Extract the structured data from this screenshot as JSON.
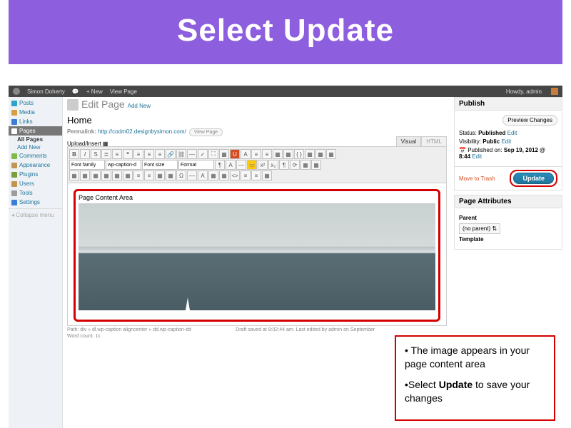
{
  "slide": {
    "title": "Select Update"
  },
  "adminbar": {
    "site": "Simon Doherty",
    "new": "+ New",
    "viewpage": "View Page",
    "howdy": "Howdy, admin"
  },
  "sidebar": {
    "items": [
      {
        "label": "Posts",
        "icon": "#2ea2cc"
      },
      {
        "label": "Media",
        "icon": "#d6a040"
      },
      {
        "label": "Links",
        "icon": "#3a7dd6"
      },
      {
        "label": "Pages",
        "icon": "#9c9c9c",
        "current": true
      },
      {
        "label": "Comments",
        "icon": "#7dbb49"
      },
      {
        "label": "Appearance",
        "icon": "#c29455"
      },
      {
        "label": "Plugins",
        "icon": "#7d9e3d"
      },
      {
        "label": "Users",
        "icon": "#c2954f"
      },
      {
        "label": "Tools",
        "icon": "#9c9c9c"
      },
      {
        "label": "Settings",
        "icon": "#3a7dd6"
      }
    ],
    "subpages": {
      "all": "All Pages",
      "add": "Add New"
    },
    "collapse": "Collapse menu"
  },
  "page": {
    "heading": "Edit Page",
    "addnew": "Add New",
    "title": "Home",
    "permalink_label": "Permalink:",
    "permalink_url": "http://codm02.designbysimon.com/",
    "viewpage_btn": "View Page",
    "upload": "Upload/Insert",
    "visual": "Visual",
    "html": "HTML",
    "font_family": "Font family",
    "caption_style": "wp-caption-d",
    "font_size": "Font size",
    "format": "Format",
    "content_caption": "Page Content Area",
    "path": "Path: div » dl.wp-caption aligncenter » dd.wp-caption-dd",
    "status_line": "Draft saved at 9:02:44 am. Last edited by admin on September",
    "wordcount": "Word count: 11"
  },
  "publish": {
    "title": "Publish",
    "preview": "Preview Changes",
    "status_label": "Status:",
    "status_val": "Published",
    "edit": "Edit",
    "vis_label": "Visibility:",
    "vis_val": "Public",
    "pub_label": "Published on:",
    "pub_val": "Sep 19, 2012 @ 8:44",
    "trash": "Move to Trash",
    "update": "Update"
  },
  "attributes": {
    "title": "Page Attributes",
    "parent": "Parent",
    "parent_val": "(no parent)",
    "template": "Template"
  },
  "callout": {
    "l1": "• The image appears in your page content area",
    "l2_a": "•Select ",
    "l2_b": "Update",
    "l2_c": " to save your changes"
  }
}
